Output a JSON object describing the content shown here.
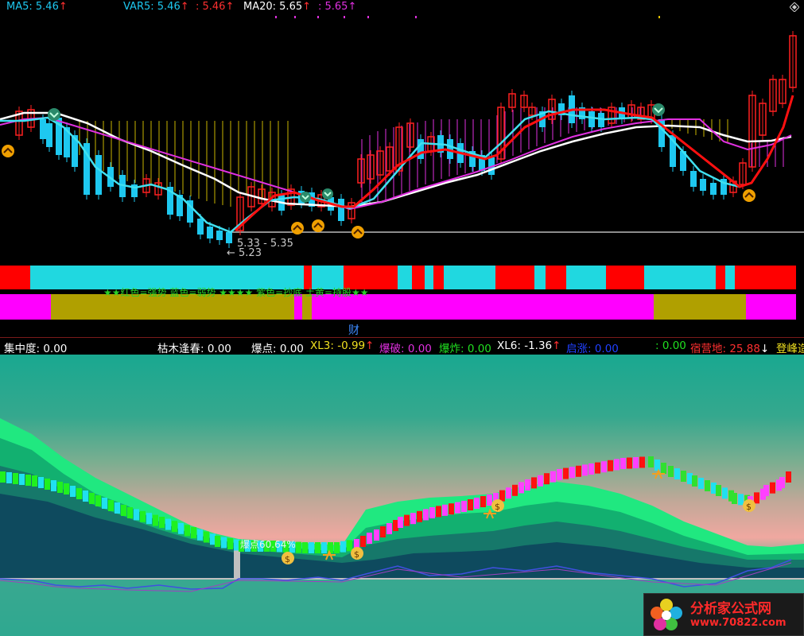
{
  "top_legend": {
    "ma5": "MA5: 5.46",
    "var5": "VAR5: 5.46",
    "var5_extra": ": 5.46",
    "ma20": "MA20: 5.65",
    "ma20_extra": ": 5.65",
    "arrow": "↑"
  },
  "main_chart": {
    "low_label_top": "5.33 - 5.35",
    "low_label_bottom": "← 5.23",
    "banner_text": "★★红色=强势 蓝色=弱势 ★★★★ 紫色=抄底 土黄=持股★★"
  },
  "signal": {
    "cai_label": "财"
  },
  "bottom_legend": {
    "jizhongdu": "集中度: 0.00",
    "kumu": "枯木逢春: 0.00",
    "baodian": "爆点: 0.00",
    "xl3": "XL3: -0.99",
    "baopo": "爆破: 0.00",
    "baozha": "爆炸: 0.00",
    "xl6": "XL6: -1.36",
    "qizhang": "启涨: 0.00",
    "blank": ": 0.00",
    "suyingdi": "宿营地: 25.88",
    "dengfeng": "登峰造",
    "up_arrow": "↑",
    "down_arrow": "↓"
  },
  "indicator": {
    "pct_label": "爆点60.64%"
  },
  "watermark": {
    "title": "分析家公式网",
    "url": "www.70822.com"
  },
  "colors": {
    "up": "#ff2020",
    "down": "#1ec8f0",
    "ma_white": "#ffffff",
    "ma_magenta": "#e030e0",
    "ma_red": "#ff1010",
    "ma_cyan": "#40e0f0"
  }
}
